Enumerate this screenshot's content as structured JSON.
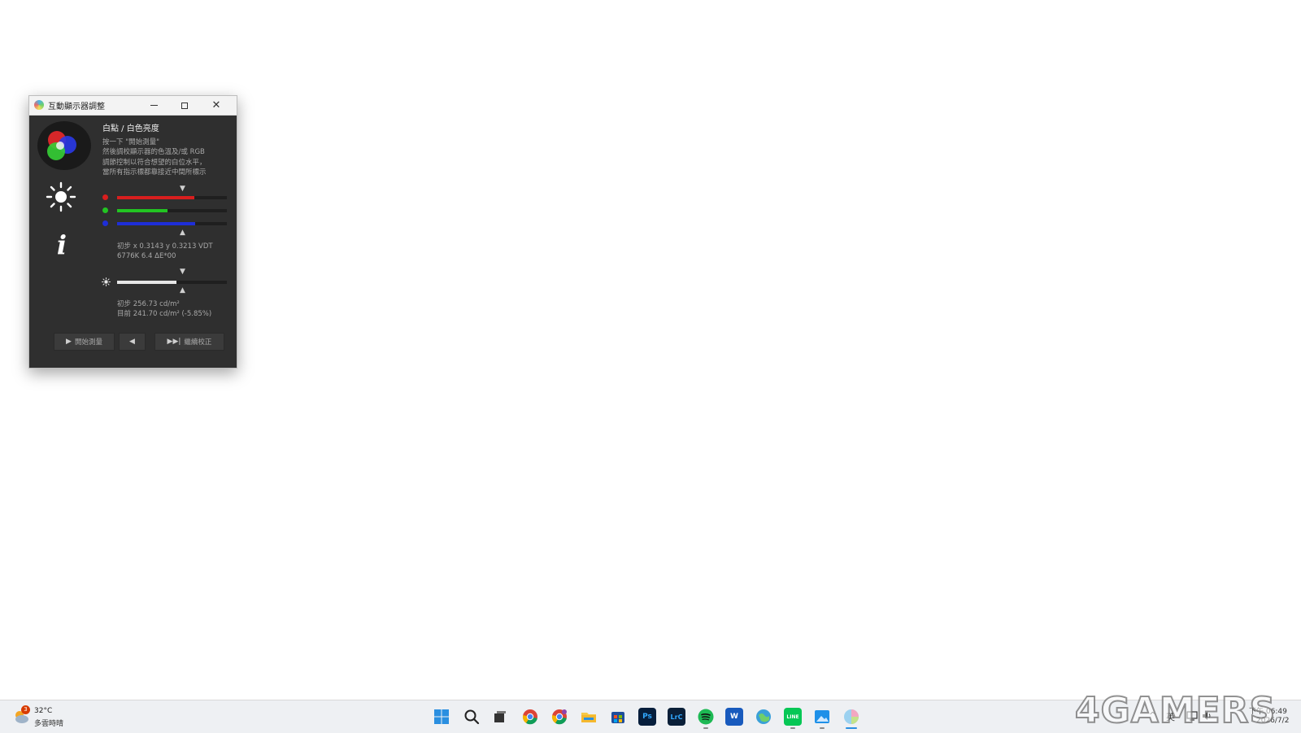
{
  "window": {
    "title": "互動顯示器調整",
    "heading": "白點 / 白色亮度",
    "instructions": [
      "按一下 \"開始測量\"",
      "然後調校顯示器的色溫及/或 RGB",
      "調節控制以符合想望的白位水平，",
      "當所有指示標都靠接近中間所標示"
    ],
    "rgb_levels": {
      "red": 0.7,
      "green": 0.46,
      "blue": 0.71
    },
    "colors": {
      "red": "#d81e1e",
      "green": "#22c422",
      "blue": "#1e2ed8",
      "luminance": "#e6e6e6"
    },
    "whitepoint_readout": [
      "初步 x 0.3143 y 0.3213 VDT",
      "6776K 6.4 ΔE*00"
    ],
    "luminance_level": 0.54,
    "luminance_readout": [
      "初步 256.73 cd/m²",
      "目前 241.70 cd/m² (-5.85%)"
    ],
    "buttons": {
      "start": "開始測量",
      "start_icon": "▶",
      "back_icon": "◀",
      "continue": "繼續校正",
      "continue_icon": "▶▶|"
    },
    "marker_icon": "▼",
    "marker_icon_up": "▲"
  },
  "taskbar": {
    "weather": {
      "temp": "32°C",
      "desc": "多雲時晴",
      "badge": "3"
    },
    "apps": [
      {
        "name": "start",
        "icon": "windows-logo"
      },
      {
        "name": "search",
        "icon": "search-icon"
      },
      {
        "name": "task-view",
        "icon": "task-view-icon"
      },
      {
        "name": "chrome",
        "icon": "chrome-icon"
      },
      {
        "name": "chrome-alt",
        "icon": "chrome-icon"
      },
      {
        "name": "file-explorer",
        "icon": "folder-icon"
      },
      {
        "name": "store",
        "icon": "store-icon"
      },
      {
        "name": "photoshop",
        "icon": "Ps"
      },
      {
        "name": "lightroom-classic",
        "icon": "LrC"
      },
      {
        "name": "spotify",
        "icon": "spotify-icon"
      },
      {
        "name": "word",
        "icon": "W"
      },
      {
        "name": "network-app",
        "icon": "globe-icon"
      },
      {
        "name": "line",
        "icon": "LINE"
      },
      {
        "name": "photos",
        "icon": "photos-icon"
      },
      {
        "name": "displaycal",
        "icon": "displaycal-icon"
      }
    ],
    "ime": "英",
    "clock": {
      "time": "下午 06:49",
      "date": "2026/7/2"
    }
  },
  "watermark": "4GAMERS"
}
